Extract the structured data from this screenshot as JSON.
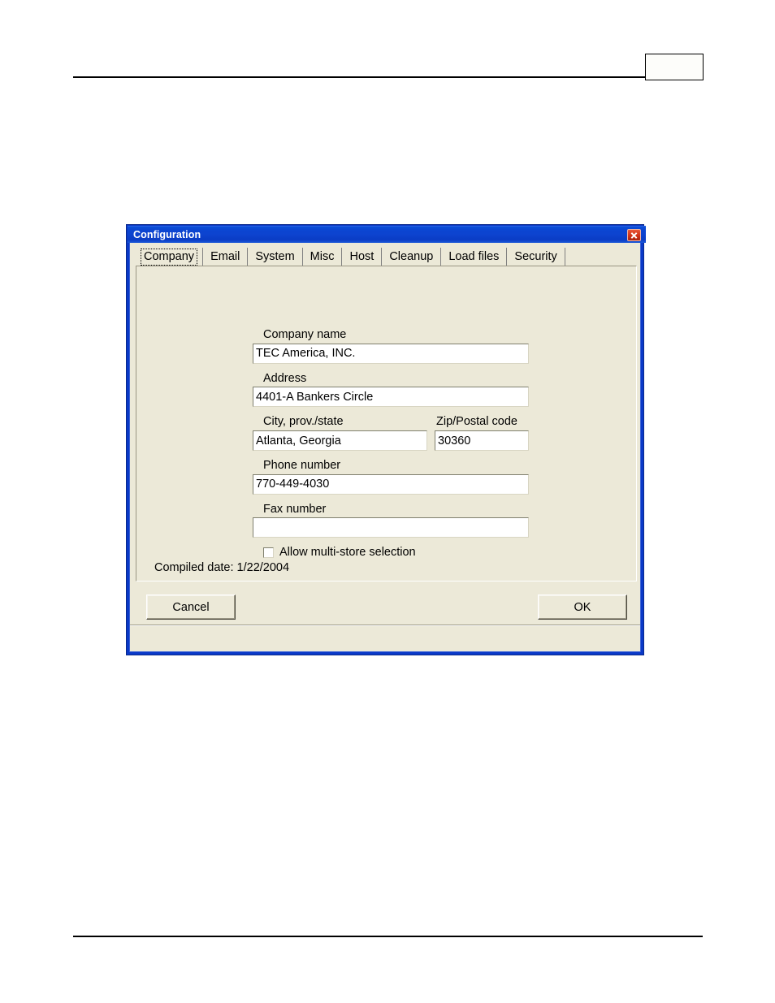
{
  "page": {
    "page_number_box": ""
  },
  "dialog": {
    "title": "Configuration",
    "close_icon": "close-icon"
  },
  "tabs": [
    {
      "label": "Company",
      "active": true
    },
    {
      "label": "Email",
      "active": false
    },
    {
      "label": "System",
      "active": false
    },
    {
      "label": "Misc",
      "active": false
    },
    {
      "label": "Host",
      "active": false
    },
    {
      "label": "Cleanup",
      "active": false
    },
    {
      "label": "Load files",
      "active": false
    },
    {
      "label": "Security",
      "active": false
    }
  ],
  "form": {
    "company_name": {
      "label": "Company name",
      "value": "TEC America, INC."
    },
    "address": {
      "label": "Address",
      "value": "4401-A Bankers Circle"
    },
    "city": {
      "label": "City, prov./state",
      "value": "Atlanta, Georgia"
    },
    "zip": {
      "label": "Zip/Postal code",
      "value": "30360"
    },
    "phone": {
      "label": "Phone number",
      "value": "770-449-4030"
    },
    "fax": {
      "label": "Fax number",
      "value": ""
    },
    "multi_store": {
      "label": "Allow multi-store selection",
      "checked": false
    }
  },
  "status": {
    "compiled_date": "Compiled date: 1/22/2004"
  },
  "buttons": {
    "cancel": "Cancel",
    "ok": "OK"
  },
  "colors": {
    "titlebar_blue": "#0d43cf",
    "window_frame": "#0a39c8",
    "dialog_face": "#ece9d8",
    "close_red": "#d23318"
  }
}
